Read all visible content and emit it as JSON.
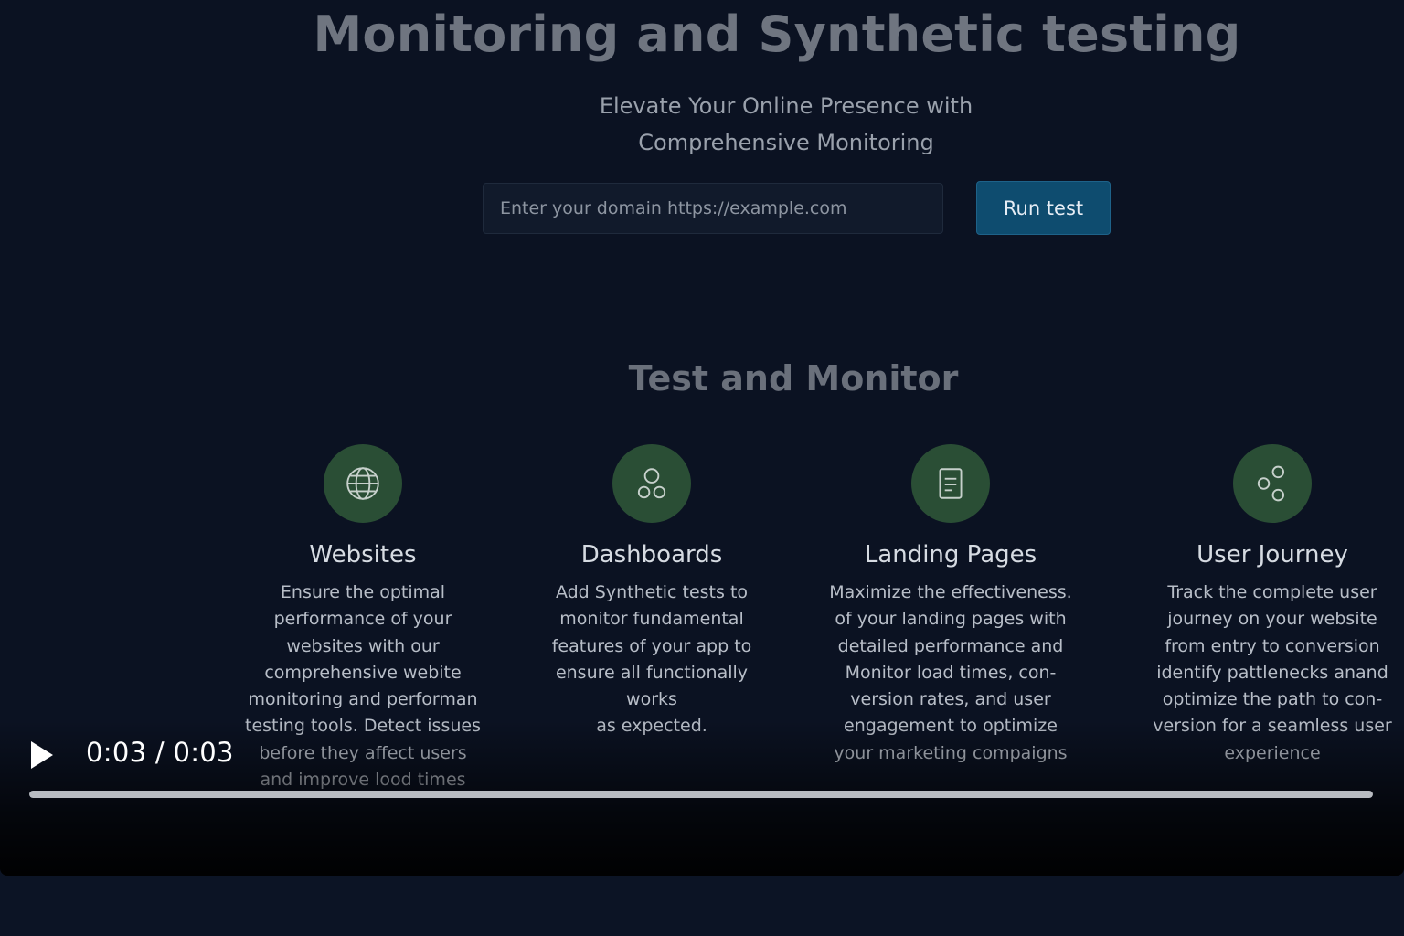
{
  "hero": {
    "title": "Monitoring and Synthetic testing",
    "subtitle_line1": "Elevate Your Online Presence with",
    "subtitle_line2": "Comprehensive Monitoring"
  },
  "domain_form": {
    "input_value": "",
    "input_placeholder": "Enter your domain https://example.com",
    "run_label": "Run test"
  },
  "section": {
    "title": "Test and Monitor"
  },
  "features": [
    {
      "icon": "globe-icon",
      "title": "Websites",
      "lines": [
        "Ensure the optimal",
        "performance of your",
        "websites with our",
        "comprehensive webite",
        "monitoring and performan",
        "testing tools. Detect issues",
        "before they affect users",
        "and improve lood times"
      ]
    },
    {
      "icon": "dashboard-circles-icon",
      "title": "Dashboards",
      "lines": [
        "Add Synthetic tests to",
        "monitor fundamental",
        "features of your app to",
        "ensure all functionally works",
        "as expected."
      ]
    },
    {
      "icon": "document-icon",
      "title": "Landing Pages",
      "lines": [
        "Maximize the effectiveness.",
        "of your landing pages with",
        "detailed performance and",
        "Monitor load times, con-",
        "version rates, and user",
        "engagement to optimize",
        "your marketing compaigns"
      ]
    },
    {
      "icon": "nodes-icon",
      "title": "User Journey",
      "lines": [
        "Track the complete user",
        "journey on your website",
        "from entry to conversion",
        "identify pattlenecks anand",
        "optimize the path to con-",
        "version for a seamless user",
        "experience"
      ]
    }
  ],
  "player": {
    "play_icon": "play-icon",
    "current_time": "0:03",
    "separator": "/",
    "duration": "0:03",
    "progress_percent": 100
  },
  "colors": {
    "background": "#0c1425",
    "button_accent": "#0e4c6f",
    "icon_circle": "#2a4e35"
  }
}
